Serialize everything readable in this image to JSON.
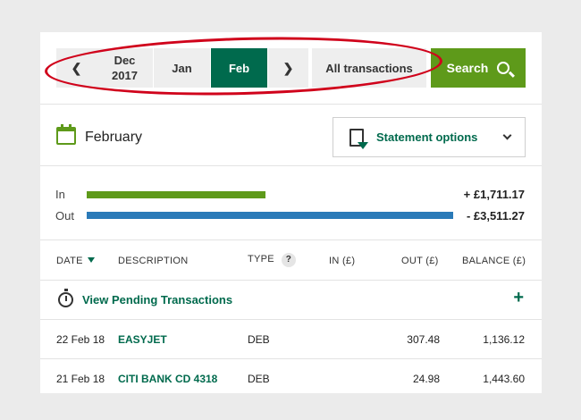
{
  "nav": {
    "prev_icon": "chevron-left-icon",
    "prev_month": {
      "line1": "Dec",
      "line2": "2017"
    },
    "months": [
      "Jan",
      "Feb"
    ],
    "active_month": "Feb",
    "next_icon": "chevron-right-icon",
    "all_transactions": "All transactions",
    "search_label": "Search",
    "search_icon": "search-icon",
    "highlight_color": "#d0021b"
  },
  "period": {
    "month": "February",
    "calendar_icon": "calendar-icon",
    "statement_options": "Statement options",
    "statement_icon": "document-download-icon"
  },
  "summary": {
    "in_label": "In",
    "in_amount": "+ £1,711.17",
    "in_value": 1711.17,
    "out_label": "Out",
    "out_amount": "- £3,511.27",
    "out_value": 3511.27,
    "in_color": "#5e9a1a",
    "out_color": "#2a7ab8"
  },
  "table": {
    "headers": {
      "date": "DATE",
      "description": "DESCRIPTION",
      "type": "TYPE",
      "type_help": "?",
      "in": "IN (£)",
      "out": "OUT (£)",
      "balance": "BALANCE (£)"
    },
    "pending": {
      "label": "View Pending Transactions",
      "toggle": "+"
    },
    "rows": [
      {
        "date": "22 Feb 18",
        "description": "EASYJET",
        "type": "DEB",
        "in": "",
        "out": "307.48",
        "balance": "1,136.12"
      },
      {
        "date": "21 Feb 18",
        "description": "CITI BANK CD 4318",
        "type": "DEB",
        "in": "",
        "out": "24.98",
        "balance": "1,443.60"
      }
    ]
  },
  "colors": {
    "brand_green": "#006a4d",
    "accent_green": "#5e9a1a"
  }
}
